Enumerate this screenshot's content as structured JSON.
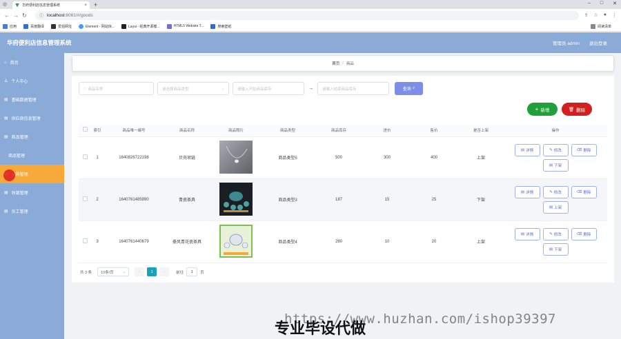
{
  "browser": {
    "tab_title": "华府便利店信息管理系统",
    "tab_new": "+",
    "url_host": "localhost",
    "url_path": ":8081/#/goods",
    "window_controls": [
      "–",
      "□",
      "✕"
    ],
    "bookmarks": [
      {
        "label": "应用",
        "color": "#4a7bd6"
      },
      {
        "label": "百度翻译",
        "color": "#2f6fd8"
      },
      {
        "label": "爱拍网址",
        "color": "#333333"
      },
      {
        "label": "Element - 网站快...",
        "color": "#409eff"
      },
      {
        "label": "Layui - 经典开源模...",
        "color": "#222222"
      },
      {
        "label": "HTML5 Website T...",
        "color": "#7a6bd8"
      },
      {
        "label": "搜索壁纸",
        "color": "#2b6fd6"
      }
    ],
    "reading_list": "阅读清单"
  },
  "header": {
    "title": "华府便利店信息管理系统",
    "admin": "管理员 admin",
    "logout": "退出登录"
  },
  "sidebar": {
    "items": [
      {
        "label": "首页",
        "type": "item"
      },
      {
        "label": "个人中心",
        "type": "item"
      },
      {
        "label": "基础数据管理",
        "type": "item"
      },
      {
        "label": "供应商信息管理",
        "type": "item"
      },
      {
        "label": "商品管理",
        "type": "item"
      },
      {
        "label": "商品管理",
        "type": "sub"
      },
      {
        "label": "采购管理",
        "type": "item",
        "active": true
      },
      {
        "label": "收银管理",
        "type": "item"
      },
      {
        "label": "员工管理",
        "type": "item"
      }
    ]
  },
  "breadcrumb": {
    "home": "首页",
    "sep": "/",
    "current": "商品"
  },
  "search": {
    "name_placeholder": "商品名称",
    "type_placeholder": "请选择商品类型",
    "stock_min_placeholder": "请输入开始商品库存",
    "range_sep": "→",
    "stock_max_placeholder": "请输入结束商品库存",
    "query_label": "查询"
  },
  "actions": {
    "add_label": "新增",
    "delete_label": "删除"
  },
  "table": {
    "headers": [
      "索引",
      "商品唯一编号",
      "商品名称",
      "商品照片",
      "商品类型",
      "商品库存",
      "进价",
      "售价",
      "是否上架",
      "操作"
    ],
    "rows": [
      {
        "index": "1",
        "code": "1640826722198",
        "name": "贝壳项链",
        "type": "商品类型5",
        "stock": "500",
        "cost": "300",
        "price": "400",
        "status": "上架",
        "toggle": "下架",
        "img": "necklace"
      },
      {
        "index": "2",
        "code": "1640761485990",
        "name": "青瓷茶具",
        "type": "商品类型3",
        "stock": "187",
        "cost": "15",
        "price": "25",
        "status": "下架",
        "toggle": "上架",
        "img": "teaset"
      },
      {
        "index": "3",
        "code": "1640761440679",
        "name": "豪风青花瓷茶具",
        "type": "商品类型4",
        "stock": "280",
        "cost": "10",
        "price": "20",
        "status": "上架",
        "toggle": "下架",
        "img": "porcelain"
      }
    ],
    "op_detail": "详情",
    "op_edit": "修改",
    "op_delete": "删除"
  },
  "pager": {
    "total": "共 3 条",
    "page_size": "10条/页",
    "current_page": "1",
    "goto_label": "前往",
    "goto_value": "1",
    "goto_suffix": "页"
  },
  "watermark": {
    "url": "https://www.huzhan.com/ishop39397",
    "text": "专业毕设代做"
  }
}
